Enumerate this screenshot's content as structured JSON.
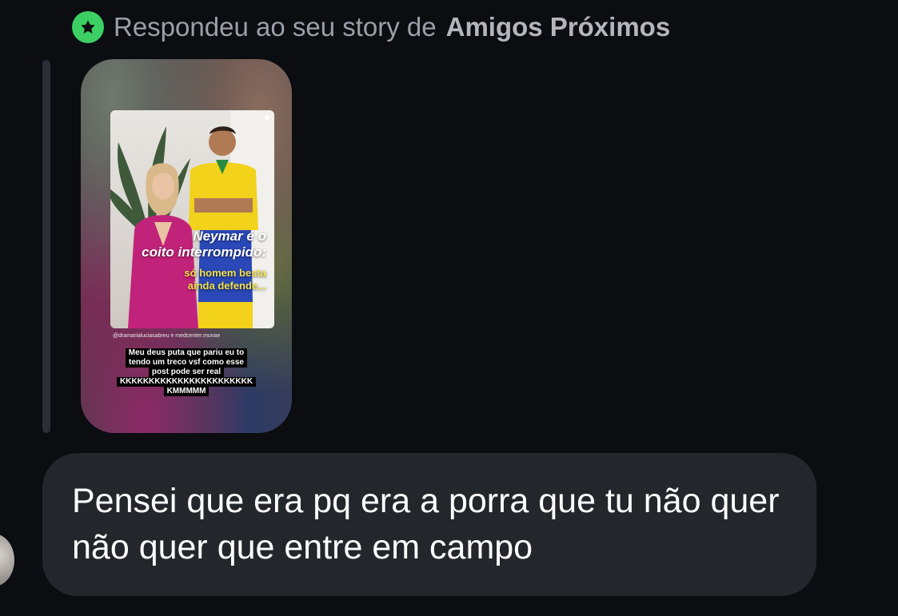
{
  "reply_header": {
    "prefix": "Respondeu ao seu story de",
    "list_name": "Amigos Próximos",
    "badge_icon": "star-icon",
    "badge_color": "#3ccf63"
  },
  "story": {
    "headline_line1": "Neymar é o",
    "headline_line2": "coito interrompido:",
    "sub_line1": "só homem besta",
    "sub_line2": "ainda defende...",
    "handle": "@dramarialuciasabreu e medcenter.munae",
    "caption_lines": [
      "Meu deus puta que pariu eu to",
      "tendo um treco vsf como esse",
      "post pode ser real",
      "KKKKKKKKKKKKKKKKKKKKKKK",
      "KMMMMM"
    ]
  },
  "message": {
    "text": "Pensei que era pq era a porra que tu não quer não quer que entre em campo"
  }
}
